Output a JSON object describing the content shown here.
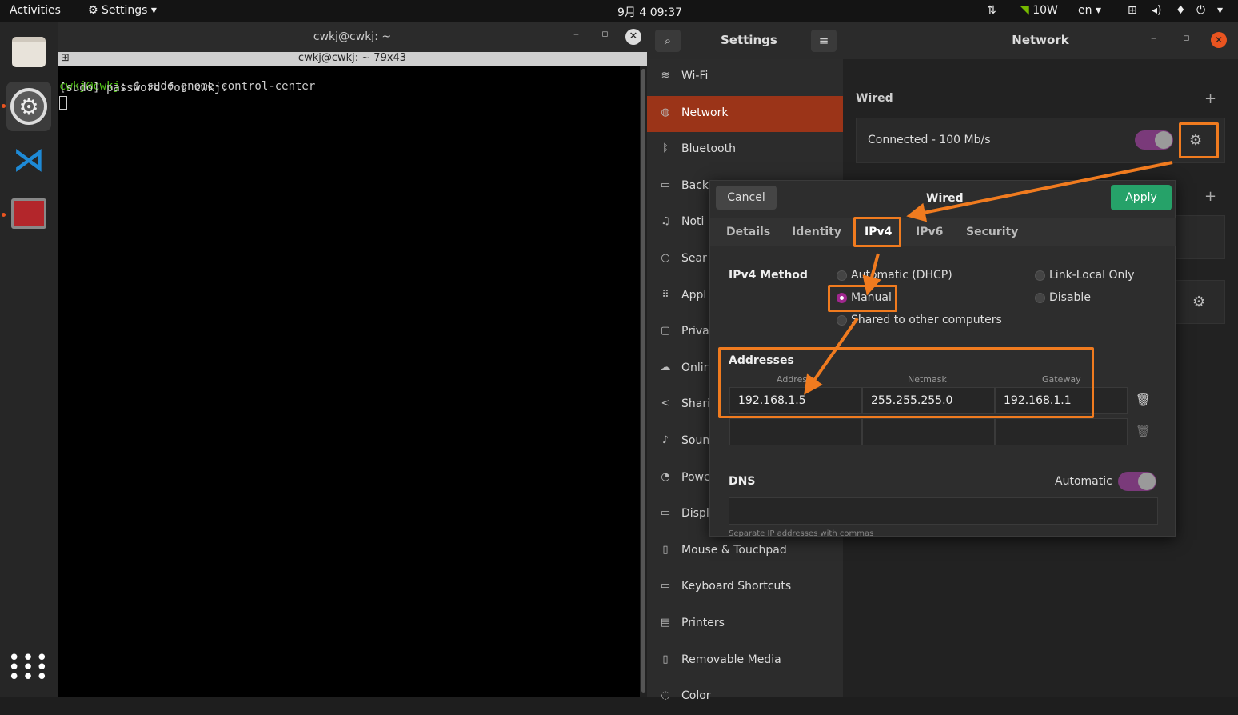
{
  "topbar": {
    "activities": "Activities",
    "app_menu": "Settings",
    "clock": "9月 4  09:37",
    "battery": "10W",
    "language": "en"
  },
  "terminal": {
    "window_title": "cwkj@cwkj: ~",
    "tab_title": "cwkj@cwkj: ~ 79x43",
    "line1_prompt": "cwkj@cwkj",
    "line1_rest": ":~$ sudo gnome-control-center",
    "line2": "[sudo] password for cwkj:"
  },
  "settings": {
    "title": "Settings",
    "items": [
      {
        "label": "Wi-Fi",
        "icon": "wifi-icon",
        "glyph": "≋"
      },
      {
        "label": "Network",
        "icon": "network-icon",
        "glyph": "◍"
      },
      {
        "label": "Bluetooth",
        "icon": "bluetooth-icon",
        "glyph": "ᛒ"
      },
      {
        "label": "Back",
        "icon": "background-icon",
        "glyph": "▭"
      },
      {
        "label": "Noti",
        "icon": "bell-icon",
        "glyph": "♫"
      },
      {
        "label": "Sear",
        "icon": "search-icon",
        "glyph": "○"
      },
      {
        "label": "Appl",
        "icon": "applications-icon",
        "glyph": "⠿"
      },
      {
        "label": "Priva",
        "icon": "lock-icon",
        "glyph": "▢"
      },
      {
        "label": "Onlir",
        "icon": "cloud-icon",
        "glyph": "☁"
      },
      {
        "label": "Shari",
        "icon": "share-icon",
        "glyph": "<"
      },
      {
        "label": "Soun",
        "icon": "music-note-icon",
        "glyph": "♪"
      },
      {
        "label": "Powe",
        "icon": "power-icon",
        "glyph": "◔"
      },
      {
        "label": "Displ",
        "icon": "display-icon",
        "glyph": "▭"
      },
      {
        "label": "Mouse & Touchpad",
        "icon": "mouse-icon",
        "glyph": "▯"
      },
      {
        "label": "Keyboard Shortcuts",
        "icon": "keyboard-icon",
        "glyph": "▭"
      },
      {
        "label": "Printers",
        "icon": "printer-icon",
        "glyph": "▤"
      },
      {
        "label": "Removable Media",
        "icon": "removable-media-icon",
        "glyph": "▯"
      },
      {
        "label": "Color",
        "icon": "color-icon",
        "glyph": "◌"
      }
    ],
    "active_index": 1
  },
  "network": {
    "title": "Network",
    "wired_label": "Wired",
    "connection_status": "Connected - 100 Mb/s"
  },
  "dialog": {
    "cancel": "Cancel",
    "title": "Wired",
    "apply": "Apply",
    "tabs": [
      "Details",
      "Identity",
      "IPv4",
      "IPv6",
      "Security"
    ],
    "active_tab": 2,
    "ipv4_method_label": "IPv4 Method",
    "methods": {
      "automatic": "Automatic (DHCP)",
      "link_local": "Link-Local Only",
      "manual": "Manual",
      "disable": "Disable",
      "shared": "Shared to other computers"
    },
    "selected_method": "Manual",
    "addresses_label": "Addresses",
    "col_address": "Address",
    "col_netmask": "Netmask",
    "col_gateway": "Gateway",
    "address": "192.168.1.5",
    "netmask": "255.255.255.0",
    "gateway": "192.168.1.1",
    "dns_label": "DNS",
    "dns_automatic": "Automatic",
    "dns_hint": "Separate IP addresses with commas"
  },
  "colors": {
    "accent_orange": "#e95420",
    "annotation": "#f07b1f",
    "apply_green": "#26a269",
    "toggle_purple": "#7a3a7a"
  }
}
